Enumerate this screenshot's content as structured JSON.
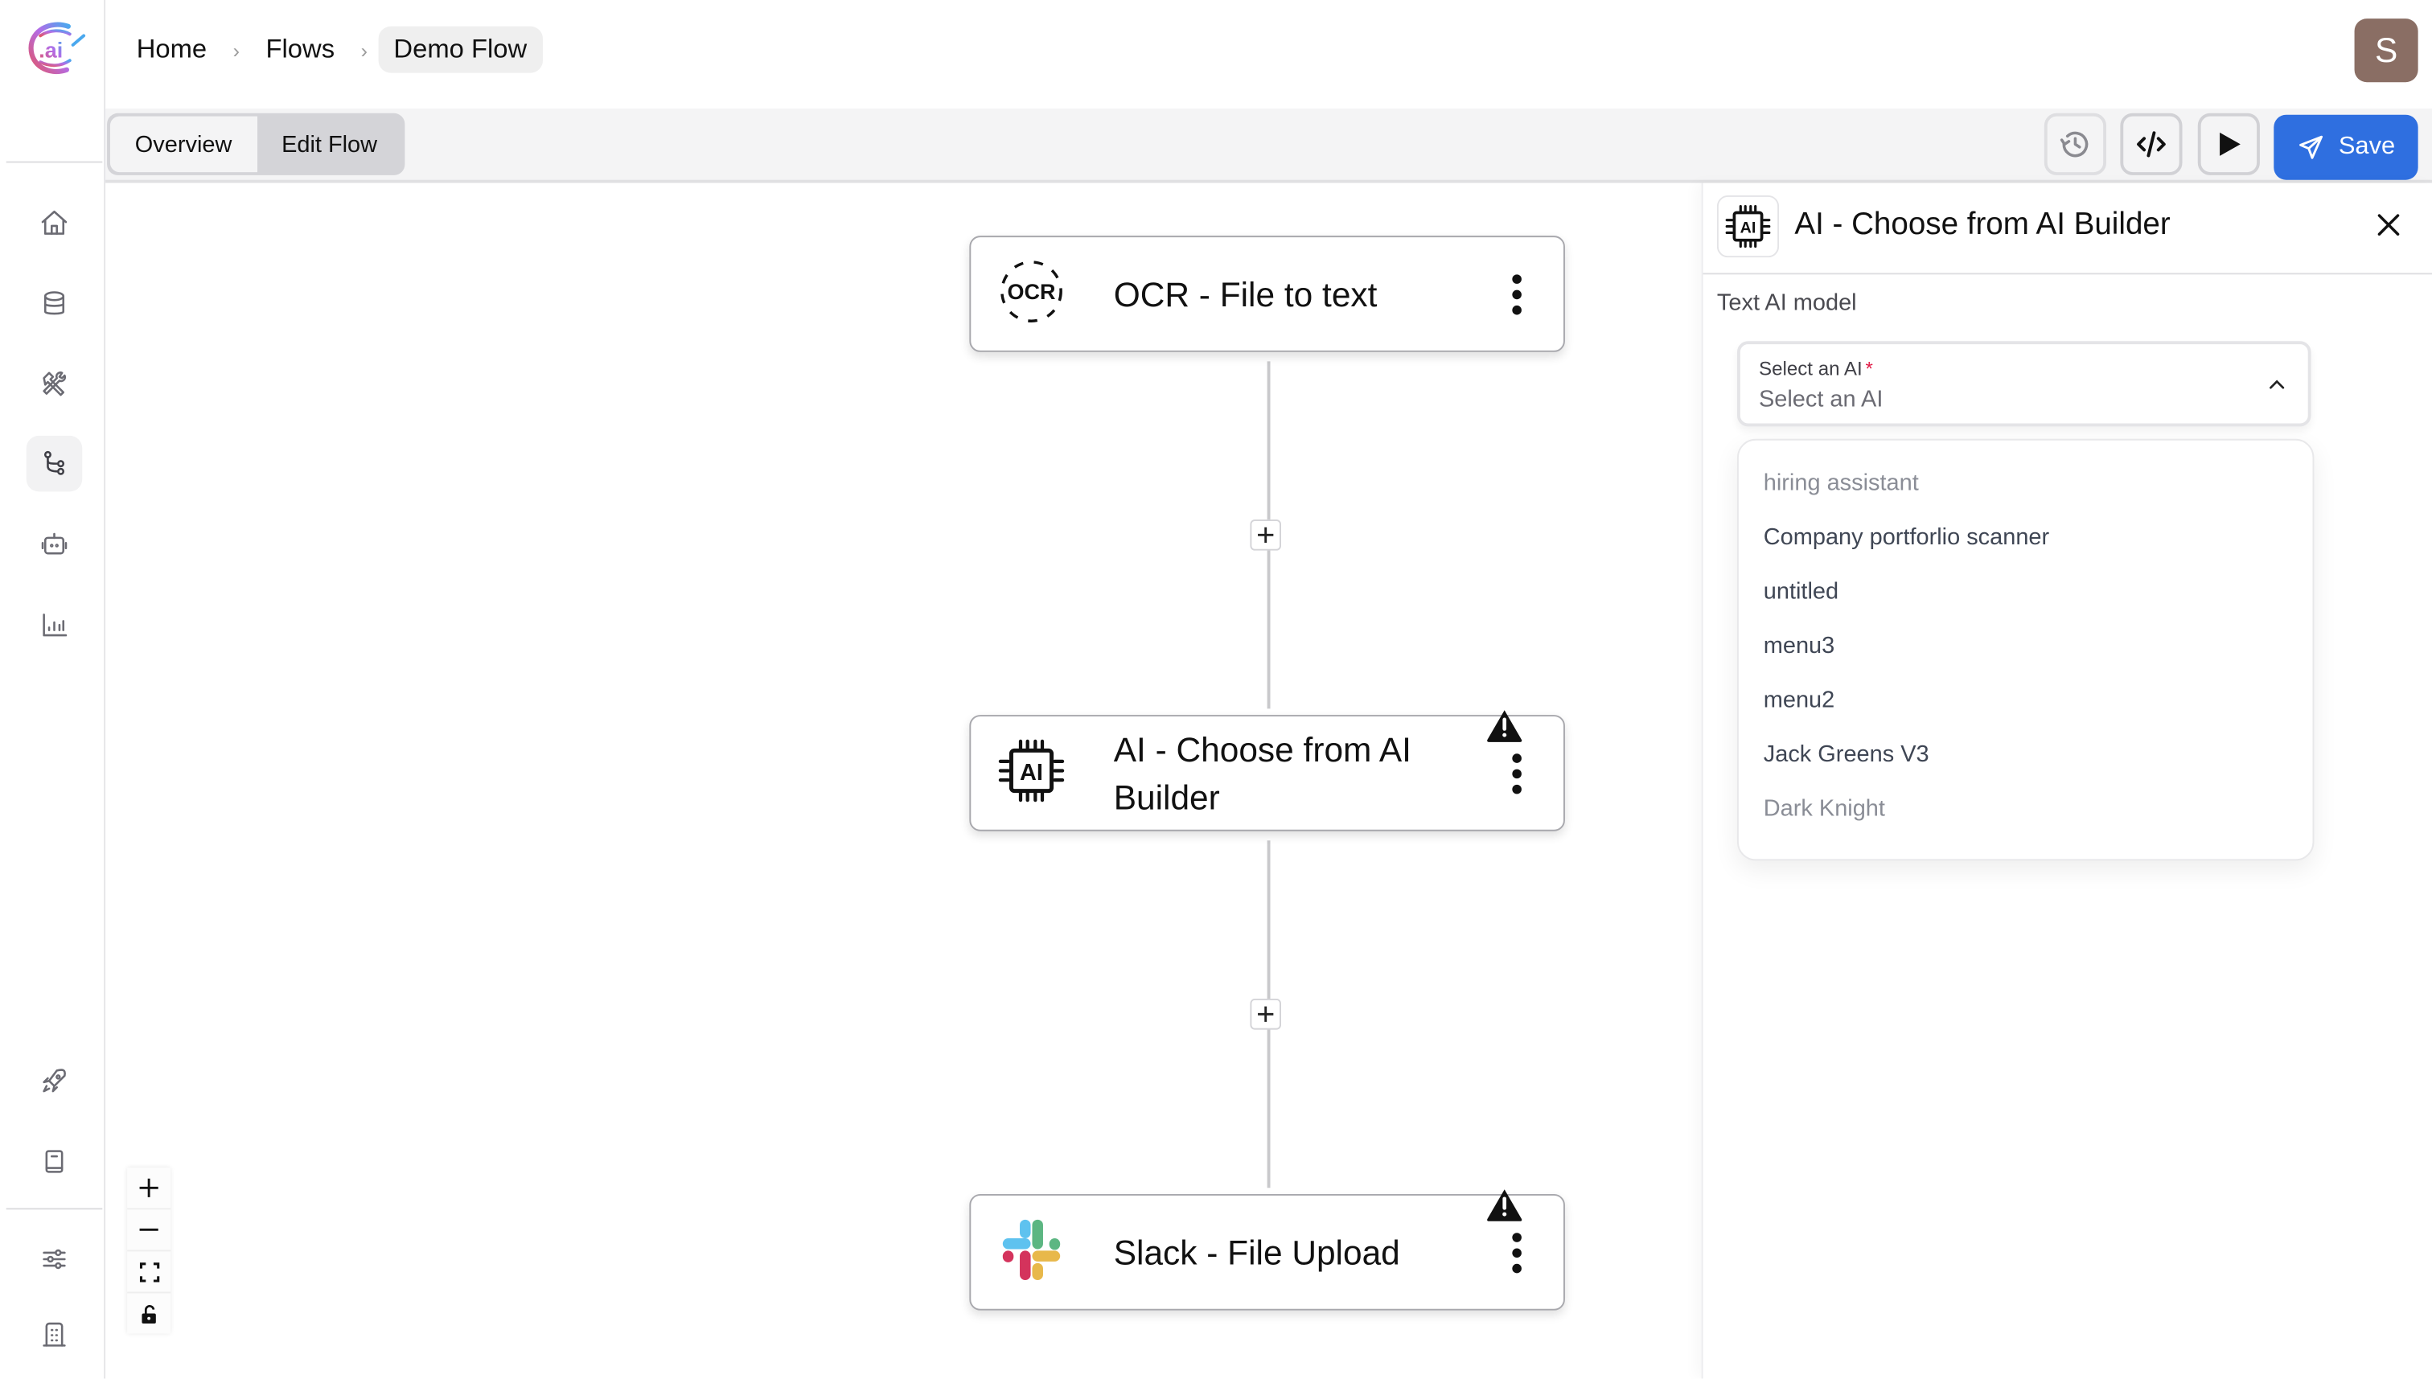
{
  "brand": {
    "logo_text": ".ai",
    "accent": "#2f6fe0"
  },
  "breadcrumb": [
    {
      "label": "Home"
    },
    {
      "label": "Flows"
    },
    {
      "label": "Demo Flow"
    }
  ],
  "breadcrumb_separator": "›",
  "user": {
    "avatar_initial": "S",
    "avatar_color": "#8a6e64"
  },
  "sidebar": {
    "items": [
      {
        "name": "home",
        "icon": "home-icon"
      },
      {
        "name": "data",
        "icon": "database-icon"
      },
      {
        "name": "tools",
        "icon": "tools-icon"
      },
      {
        "name": "flows",
        "icon": "flow-icon",
        "active": true
      },
      {
        "name": "agents",
        "icon": "robot-icon"
      },
      {
        "name": "analytics",
        "icon": "bar-chart-icon"
      },
      {
        "name": "launch",
        "icon": "rocket-icon"
      },
      {
        "name": "docs",
        "icon": "book-icon"
      },
      {
        "name": "settings",
        "icon": "sliders-icon"
      },
      {
        "name": "organization",
        "icon": "building-icon"
      }
    ]
  },
  "toolbar": {
    "tabs": [
      {
        "label": "Overview",
        "active": false
      },
      {
        "label": "Edit Flow",
        "active": true
      }
    ],
    "history_icon": "history-icon",
    "code_icon": "code-icon",
    "run_icon": "play-icon",
    "save_label": "Save"
  },
  "flow": {
    "nodes": [
      {
        "title": "OCR - File to text",
        "icon": "ocr-icon",
        "warning": false
      },
      {
        "title": "AI - Choose from AI Builder",
        "icon": "ai-chip-icon",
        "warning": true
      },
      {
        "title": "Slack - File Upload",
        "icon": "slack-icon",
        "warning": true
      }
    ],
    "zoom_controls": [
      "zoom-in",
      "zoom-out",
      "fit-view",
      "lock"
    ]
  },
  "panel": {
    "title": "AI - Choose from AI Builder",
    "field_label": "Text AI model",
    "select": {
      "label": "Select an AI",
      "required_mark": "*",
      "placeholder": "Select an AI",
      "open": true
    },
    "options": [
      {
        "label": "hiring assistant",
        "muted": true
      },
      {
        "label": "Company portforlio scanner",
        "muted": false
      },
      {
        "label": "untitled",
        "muted": false
      },
      {
        "label": "menu3",
        "muted": false
      },
      {
        "label": "menu2",
        "muted": false
      },
      {
        "label": "Jack Greens V3",
        "muted": false
      },
      {
        "label": "Dark Knight",
        "muted": true
      }
    ]
  }
}
